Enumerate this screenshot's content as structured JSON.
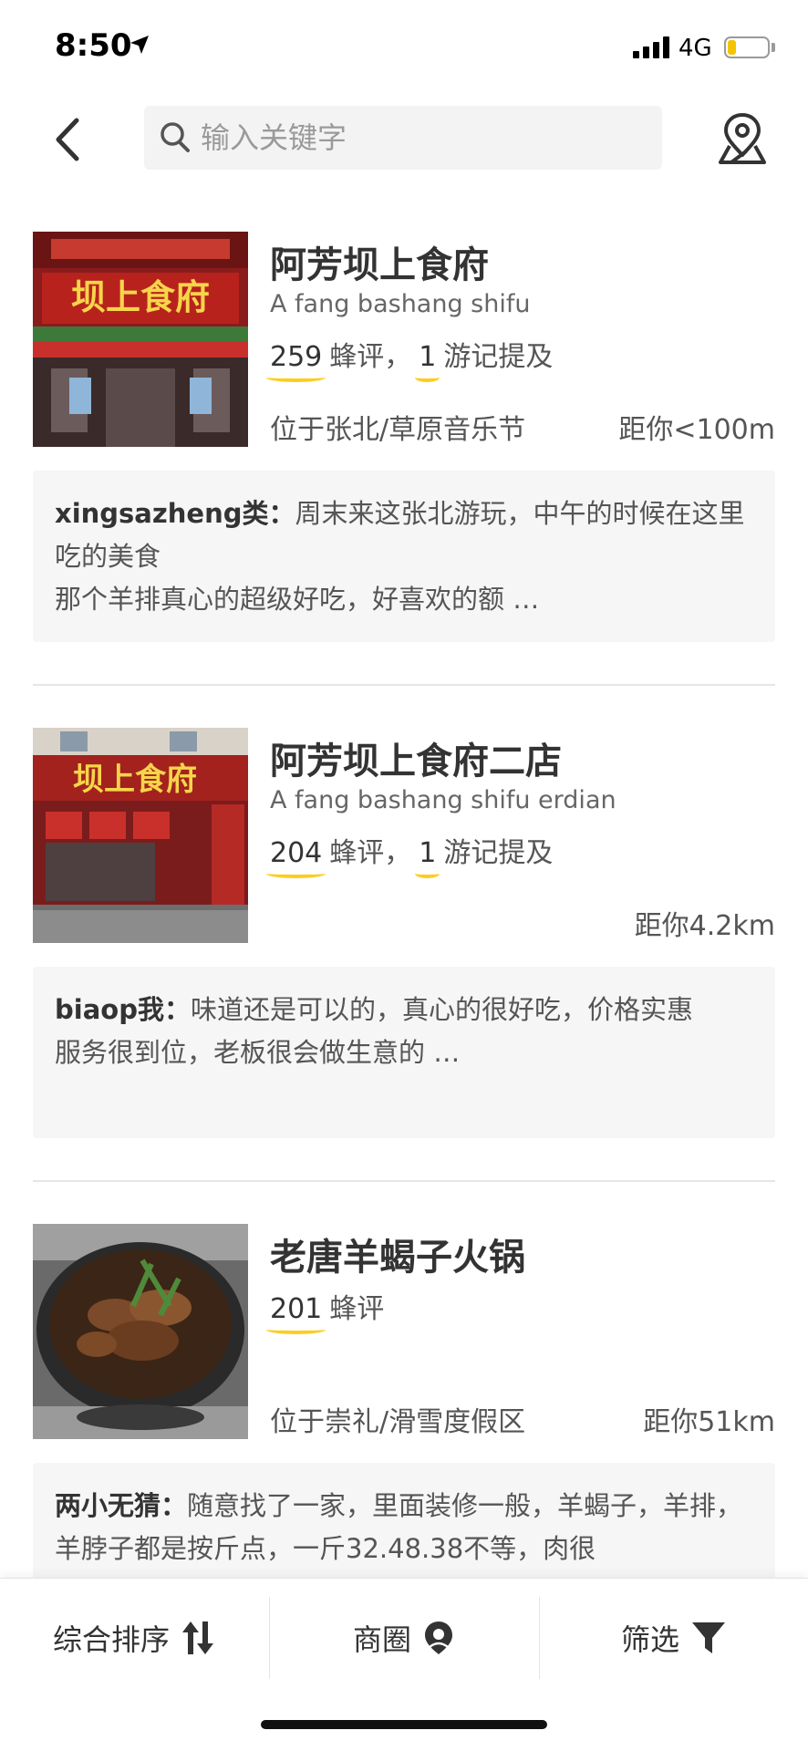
{
  "status_bar": {
    "time": "8:50",
    "network": "4G",
    "battery_level": 0.22,
    "battery_color": "#f5c400"
  },
  "header": {
    "search_placeholder": "输入关键字",
    "back_icon": "chevron-left-icon",
    "search_icon": "search-icon",
    "map_icon": "map-pin-icon"
  },
  "restaurants": [
    {
      "name": "阿芳坝上食府",
      "pinyin": "A fang bashang shifu",
      "reviews_count": "259",
      "reviews_label": "蜂评",
      "travel_count": "1",
      "travel_label": "游记提及",
      "location": "位于张北/草原音乐节",
      "distance": "距你<100m",
      "review_author": "xingsazheng类：",
      "review_text": "周末来这张北游玩，中午的时候在这里吃的美食\n那个羊排真心的超级好吃，好喜欢的额 …",
      "image_sign_text": "坝上食府"
    },
    {
      "name": "阿芳坝上食府二店",
      "pinyin": "A fang bashang shifu erdian",
      "reviews_count": "204",
      "reviews_label": "蜂评",
      "travel_count": "1",
      "travel_label": "游记提及",
      "location": "",
      "distance": "距你4.2km",
      "review_author": "biaop我：",
      "review_text": "味道还是可以的，真心的很好吃，价格实惠\n服务很到位，老板很会做生意的 …",
      "image_sign_text": "坝上食府"
    },
    {
      "name": "老唐羊蝎子火锅",
      "pinyin": "",
      "reviews_count": "201",
      "reviews_label": "蜂评",
      "travel_count": "",
      "travel_label": "",
      "location": "位于崇礼/滑雪度假区",
      "distance": "距你51km",
      "review_author": "两小无猜：",
      "review_text": "随意找了一家，里面装修一般，羊蝎子，羊排，羊脖子都是按斤点，一斤32.48.38不等，肉很"
    }
  ],
  "bottom_bar": {
    "sort_label": "综合排序",
    "area_label": "商圈",
    "filter_label": "筛选"
  },
  "colors": {
    "accent_underline": "#ffcc1f",
    "review_bg": "#f6f6f6"
  }
}
